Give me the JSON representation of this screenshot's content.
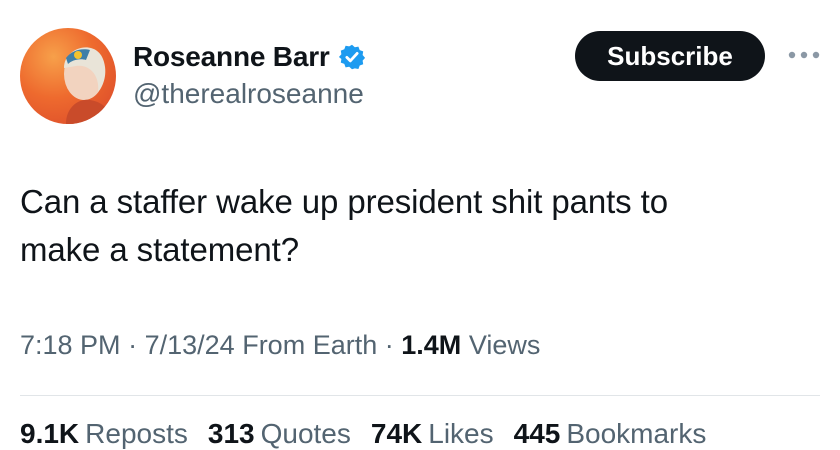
{
  "author": {
    "name": "Roseanne Barr",
    "handle": "@therealroseanne",
    "verified_icon": "verified-badge-icon",
    "avatar_bg": "#ee6a2e"
  },
  "actions": {
    "subscribe_label": "Subscribe",
    "more_icon": "more-horizontal-icon"
  },
  "tweet": {
    "text_line1": "Can a staffer wake up president shit pants to",
    "text_line2": "make a statement?"
  },
  "meta": {
    "time": "7:18 PM",
    "sep1": "·",
    "date": "7/13/24",
    "source": "From Earth",
    "sep2": "·",
    "views_count": "1.4M",
    "views_label": "Views"
  },
  "stats": [
    {
      "count": "9.1K",
      "label": "Reposts"
    },
    {
      "count": "313",
      "label": "Quotes"
    },
    {
      "count": "74K",
      "label": "Likes"
    },
    {
      "count": "445",
      "label": "Bookmarks"
    }
  ],
  "colors": {
    "text": "#0f1419",
    "secondary": "#536471",
    "verified": "#1d9bf0",
    "button_bg": "#0f1419"
  }
}
